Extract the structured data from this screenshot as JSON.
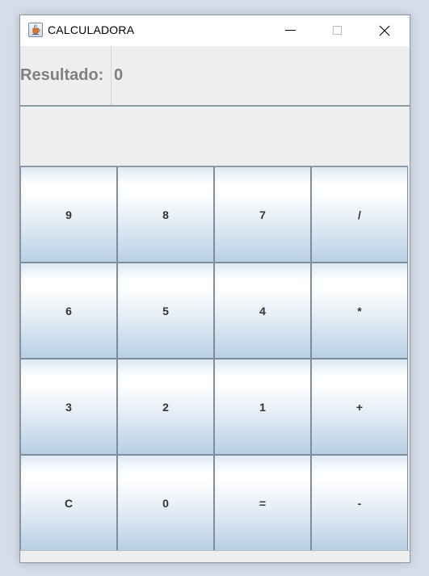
{
  "window": {
    "title": "CALCULADORA",
    "app_icon": "java-cup-icon",
    "controls": {
      "minimize_icon": "minimize-icon",
      "maximize_icon": "maximize-icon",
      "close_icon": "close-icon"
    }
  },
  "result": {
    "label": "Resultado:",
    "value": "0"
  },
  "keypad": {
    "keys": [
      "9",
      "8",
      "7",
      "/",
      "6",
      "5",
      "4",
      "*",
      "3",
      "2",
      "1",
      "+",
      "C",
      "0",
      "=",
      "-"
    ]
  },
  "colors": {
    "label_gray": "#808080",
    "panel_bg": "#eeeeee",
    "key_gradient_bottom": "#b8cfe4",
    "key_border": "#7e8c9e"
  }
}
